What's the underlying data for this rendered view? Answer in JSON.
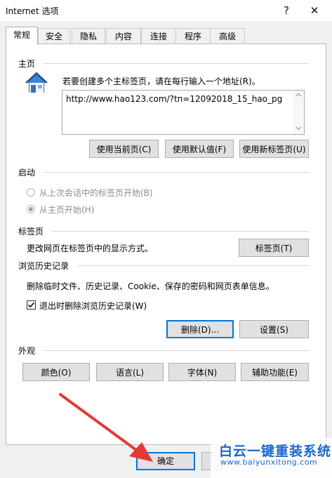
{
  "window": {
    "title": "Internet 选项",
    "help_glyph": "?",
    "close_glyph": "✕"
  },
  "tabs": [
    {
      "label": "常规"
    },
    {
      "label": "安全"
    },
    {
      "label": "隐私"
    },
    {
      "label": "内容"
    },
    {
      "label": "连接"
    },
    {
      "label": "程序"
    },
    {
      "label": "高级"
    }
  ],
  "homepage": {
    "section_title": "主页",
    "instruction": "若要创建多个主标签页，请在每行输入一个地址(R)。",
    "url_value": "http://www.hao123.com/?tn=12092018_15_hao_pg",
    "buttons": {
      "use_current": "使用当前页(C)",
      "use_default": "使用默认值(F)",
      "use_new_tab": "使用新标签页(U)"
    }
  },
  "startup": {
    "section_title": "启动",
    "option_last_session": "从上次会话中的标签页开始(B)",
    "option_homepage": "从主页开始(H)"
  },
  "tabs_section": {
    "section_title": "标签页",
    "description": "更改网页在标签页中的显示方式。",
    "button": "标签页(T)"
  },
  "history": {
    "section_title": "浏览历史记录",
    "description": "删除临时文件、历史记录、Cookie、保存的密码和网页表单信息。",
    "checkbox_label": "退出时删除浏览历史记录(W)",
    "checkbox_checked": true,
    "delete_button": "删除(D)...",
    "settings_button": "设置(S)"
  },
  "appearance": {
    "section_title": "外观",
    "buttons": {
      "colors": "颜色(O)",
      "languages": "语言(L)",
      "fonts": "字体(N)",
      "accessibility": "辅助功能(E)"
    }
  },
  "footer": {
    "ok_button": "确定"
  },
  "watermark": {
    "brand": "白云一键重装系统",
    "url": "www.baiyunxitong.com"
  },
  "colors": {
    "arrow_red": "#e53935",
    "focus_blue": "#0078d7",
    "watermark_blue": "#1a68c9"
  }
}
